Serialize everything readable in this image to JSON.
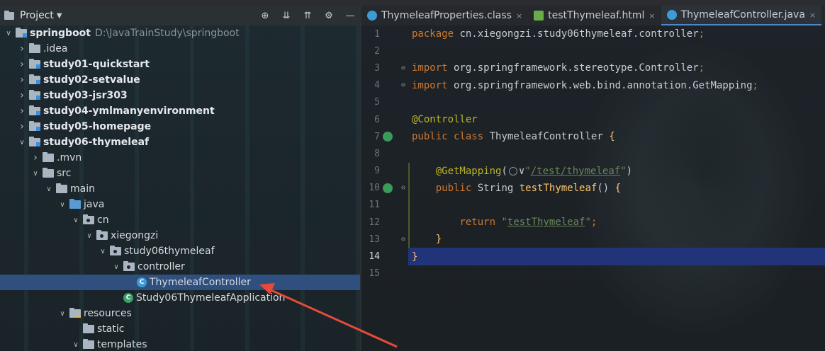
{
  "project_panel": {
    "title": "Project",
    "tree": [
      {
        "label": "springboot",
        "path": "D:\\JavaTrainStudy\\springboot",
        "indent": 0,
        "expanded": true,
        "type": "module",
        "bold": true
      },
      {
        "label": ".idea",
        "indent": 1,
        "expanded": false,
        "type": "folder"
      },
      {
        "label": "study01-quickstart",
        "indent": 1,
        "expanded": false,
        "type": "module",
        "bold": true
      },
      {
        "label": "study02-setvalue",
        "indent": 1,
        "expanded": false,
        "type": "module",
        "bold": true
      },
      {
        "label": "study03-jsr303",
        "indent": 1,
        "expanded": false,
        "type": "module",
        "bold": true
      },
      {
        "label": "study04-ymlmanyenvironment",
        "indent": 1,
        "expanded": false,
        "type": "module",
        "bold": true
      },
      {
        "label": "study05-homepage",
        "indent": 1,
        "expanded": false,
        "type": "module",
        "bold": true
      },
      {
        "label": "study06-thymeleaf",
        "indent": 1,
        "expanded": true,
        "type": "module",
        "bold": true
      },
      {
        "label": ".mvn",
        "indent": 2,
        "expanded": false,
        "type": "folder"
      },
      {
        "label": "src",
        "indent": 2,
        "expanded": true,
        "type": "folder"
      },
      {
        "label": "main",
        "indent": 3,
        "expanded": true,
        "type": "folder"
      },
      {
        "label": "java",
        "indent": 4,
        "expanded": true,
        "type": "src"
      },
      {
        "label": "cn",
        "indent": 5,
        "expanded": true,
        "type": "pkg"
      },
      {
        "label": "xiegongzi",
        "indent": 6,
        "expanded": true,
        "type": "pkg"
      },
      {
        "label": "study06thymeleaf",
        "indent": 7,
        "expanded": true,
        "type": "pkg"
      },
      {
        "label": "controller",
        "indent": 8,
        "expanded": true,
        "type": "pkg"
      },
      {
        "label": "ThymeleafController",
        "indent": 9,
        "type": "class",
        "selected": true
      },
      {
        "label": "Study06ThymeleafApplication",
        "indent": 8,
        "type": "app"
      },
      {
        "label": "resources",
        "indent": 4,
        "expanded": true,
        "type": "res"
      },
      {
        "label": "static",
        "indent": 5,
        "type": "folder"
      },
      {
        "label": "templates",
        "indent": 5,
        "expanded": true,
        "type": "folder"
      }
    ]
  },
  "editor": {
    "tabs": [
      {
        "label": "ThymeleafProperties.class",
        "icon": "class",
        "active": false
      },
      {
        "label": "testThymeleaf.html",
        "icon": "html",
        "active": false
      },
      {
        "label": "ThymeleafController.java",
        "icon": "class",
        "active": true
      }
    ],
    "current_line": 14,
    "lines": [
      "package cn.xiegongzi.study06thymeleaf.controller;",
      "",
      "import org.springframework.stereotype.Controller;",
      "import org.springframework.web.bind.annotation.GetMapping;",
      "",
      "@Controller",
      "public class ThymeleafController {",
      "",
      "    @GetMapping(\"/test/thymeleaf\")",
      "    public String testThymeleaf() {",
      "",
      "        return \"testThymeleaf\";",
      "    }",
      "}",
      ""
    ]
  },
  "colors": {
    "selection": "#2f4f7f",
    "current_line": "#21347a",
    "keyword": "#cc7832",
    "annotation": "#bbb529",
    "string": "#6a8759",
    "class_icon": "#3d9bd6",
    "arrow": "#e84a3a"
  }
}
